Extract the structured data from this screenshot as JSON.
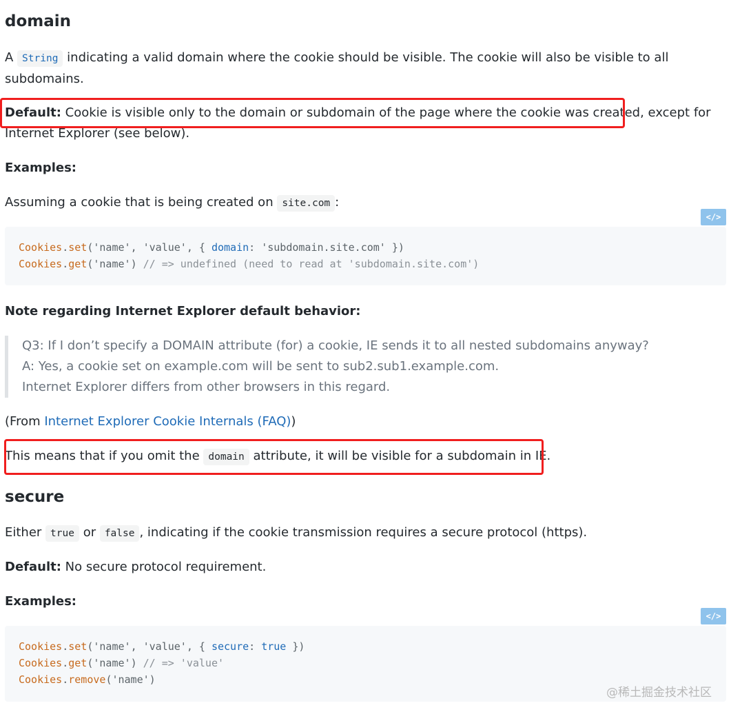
{
  "domain_section": {
    "heading": "domain",
    "desc_a": "A ",
    "desc_code": "String",
    "desc_b": " indicating a valid domain where the cookie should be visible. The cookie will also be visible to all",
    "desc_c": "subdomains.",
    "default_label": "Default:",
    "default_text_a": " Cookie is visible only to the domain or subdomain of the page where the cookie was created, except for",
    "default_text_b": "Internet Explorer (see below).",
    "examples_label": "Examples:",
    "assuming_a": "Assuming a cookie that is being created on ",
    "assuming_code": "site.com",
    "assuming_b": ":",
    "code": {
      "l1_obj": "Cookies",
      "l1_dot": ".",
      "l1_fn": "set",
      "l1_p1": "(",
      "l1_s1": "'name'",
      "l1_c1": ", ",
      "l1_s2": "'value'",
      "l1_c2": ", { ",
      "l1_key": "domain",
      "l1_colon": ": ",
      "l1_s3": "'subdomain.site.com'",
      "l1_end": " })",
      "l2_obj": "Cookies",
      "l2_dot": ".",
      "l2_fn": "get",
      "l2_p1": "(",
      "l2_s1": "'name'",
      "l2_p2": ") ",
      "l2_com": "// => undefined (need to read at 'subdomain.site.com')"
    },
    "copy_icon": "</>",
    "note_label": "Note regarding Internet Explorer default behavior:",
    "quote_lines": [
      "Q3: If I don’t specify a DOMAIN attribute (for) a cookie, IE sends it to all nested subdomains anyway?",
      "A: Yes, a cookie set on example.com will be sent to sub2.sub1.example.com.",
      "Internet Explorer differs from other browsers in this regard."
    ],
    "from_a": "(From ",
    "from_link": "Internet Explorer Cookie Internals (FAQ)",
    "from_b": ")",
    "means_a": "This means that if you omit the ",
    "means_code": "domain",
    "means_b": " attribute, it will be visible for a subdomain in IE."
  },
  "secure_section": {
    "heading": "secure",
    "either_a": "Either ",
    "either_code1": "true",
    "either_or": " or ",
    "either_code2": "false",
    "either_b": ", indicating if the cookie transmission requires a secure protocol (https).",
    "default_label": "Default:",
    "default_text": " No secure protocol requirement.",
    "examples_label": "Examples:",
    "code": {
      "l1_obj": "Cookies",
      "l1_dot": ".",
      "l1_fn": "set",
      "l1_p1": "(",
      "l1_s1": "'name'",
      "l1_c1": ", ",
      "l1_s2": "'value'",
      "l1_c2": ", { ",
      "l1_key": "secure",
      "l1_colon": ": ",
      "l1_kw": "true",
      "l1_end": " })",
      "l2_obj": "Cookies",
      "l2_dot": ".",
      "l2_fn": "get",
      "l2_p1": "(",
      "l2_s1": "'name'",
      "l2_p2": ") ",
      "l2_com": "// => 'value'",
      "l3_obj": "Cookies",
      "l3_dot": ".",
      "l3_fn": "remove",
      "l3_p1": "(",
      "l3_s1": "'name'",
      "l3_p2": ")"
    },
    "copy_icon": "</>"
  },
  "watermark": "@稀土掘金技术社区",
  "colors": {
    "highlight_box": "#f01e1e",
    "link": "#1f6bb7",
    "copy_button": "#8fc3ec",
    "code_bg": "#f6f8fa"
  }
}
